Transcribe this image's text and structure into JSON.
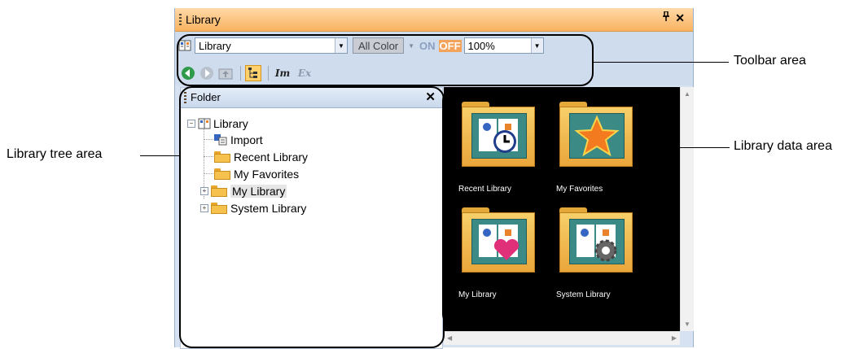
{
  "window": {
    "title": "Library",
    "pin_glyph": "٢",
    "close_glyph": "✕"
  },
  "toolbar": {
    "library_combo": "Library",
    "color_combo": "All Color",
    "on_label": "ON",
    "off_label": "OFF",
    "zoom": "100%",
    "im_label": "Im",
    "ex_label": "Ex"
  },
  "folder_pane": {
    "title": "Folder",
    "close_glyph": "✕",
    "tree": {
      "root": "Library",
      "import": "Import",
      "recent": "Recent Library",
      "favorites": "My Favorites",
      "my_library": "My Library",
      "system_library": "System Library"
    }
  },
  "data_area": {
    "items": [
      "Recent Library",
      "My Favorites",
      "My Library",
      "System Library"
    ]
  },
  "annotations": {
    "toolbar_area": "Toolbar area",
    "library_tree_area": "Library tree area",
    "library_data_area": "Library data area"
  },
  "colors": {
    "titlebar": "#f9b35f",
    "panel_bg": "#cfdcee",
    "data_bg": "#000000",
    "folder": "#f6c24d",
    "accent_off": "#f4a35b"
  }
}
